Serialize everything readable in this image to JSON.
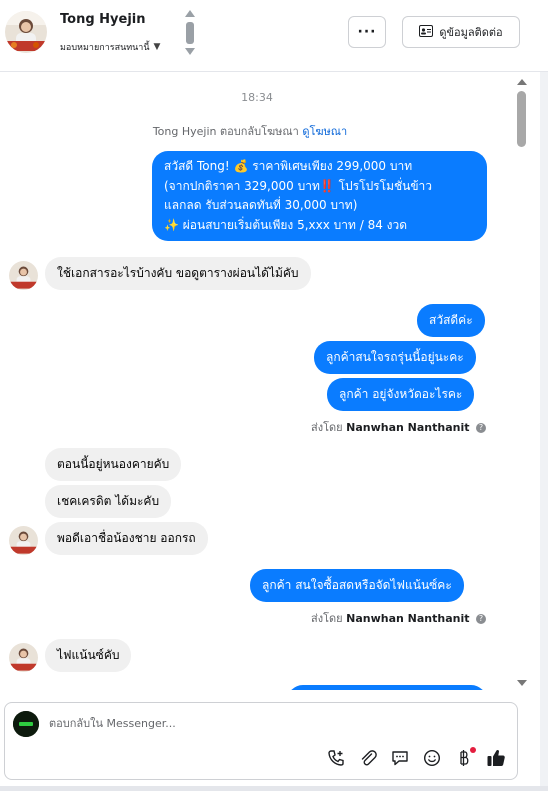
{
  "header": {
    "contact_name": "Tong Hyejin",
    "assign_label": "มอบหมายการสนทนานี้",
    "more_label": "···",
    "contact_button_label": "ดูข้อมูลติดต่อ"
  },
  "chat": {
    "timestamp": "18:34",
    "ad_reply_prefix": "Tong Hyejin ตอบกลับโฆษณา",
    "ad_link_label": "ดูโฆษณา",
    "messages": [
      {
        "direction": "out",
        "lines": [
          "สวัสดี Tong! 💰 ราคาพิเศษเพียง 299,000 บาท",
          "(จากปกติราคา 329,000 บาท‼️ โปรโปรโมชั่นข้าว",
          "แลกลด รับส่วนลดทันที่ 30,000 บาท)",
          "✨ ผ่อนสบายเริ่มต้นเพียง 5,xxx บาท / 84 งวด"
        ]
      },
      {
        "direction": "in",
        "text": "ใช้เอกสารอะไรบ้างคับ ขอดูตารางผ่อนได้ไม้คับ"
      },
      {
        "direction": "out",
        "text": "สวัสดีค่ะ"
      },
      {
        "direction": "out",
        "text": "ลูกค้าสนใจรถรุ่นนี้อยู่นะคะ"
      },
      {
        "direction": "out",
        "text": "ลูกค้า อยู่จังหวัดอะไรคะ"
      },
      {
        "direction": "in",
        "text": "ตอนนี้อยู่หนองคายคับ"
      },
      {
        "direction": "in",
        "text": "เชคเครดิต ได้มะคับ"
      },
      {
        "direction": "in",
        "text": "พอดีเอาชื่อน้องชาย ออกรถ"
      },
      {
        "direction": "out",
        "text": "ลูกค้า สนใจซื้อสดหรือจัดไฟแน้นซ์คะ"
      },
      {
        "direction": "in",
        "text": "ไฟแน้นซ์คับ"
      }
    ],
    "sent_by_prefix": "ส่งโดย",
    "sent_by_name": "Nanwhan Nanthanit",
    "info_glyph": "?"
  },
  "composer": {
    "placeholder": "ตอบกลับใน Messenger...",
    "tools": [
      "phone-plus-icon",
      "attachment-icon",
      "saved-reply-icon",
      "emoji-icon",
      "payment-icon",
      "thumbs-up-icon"
    ]
  },
  "colors": {
    "accent": "#0a7cff",
    "incoming": "#f0f0f0",
    "badge": "#e41e3f"
  }
}
